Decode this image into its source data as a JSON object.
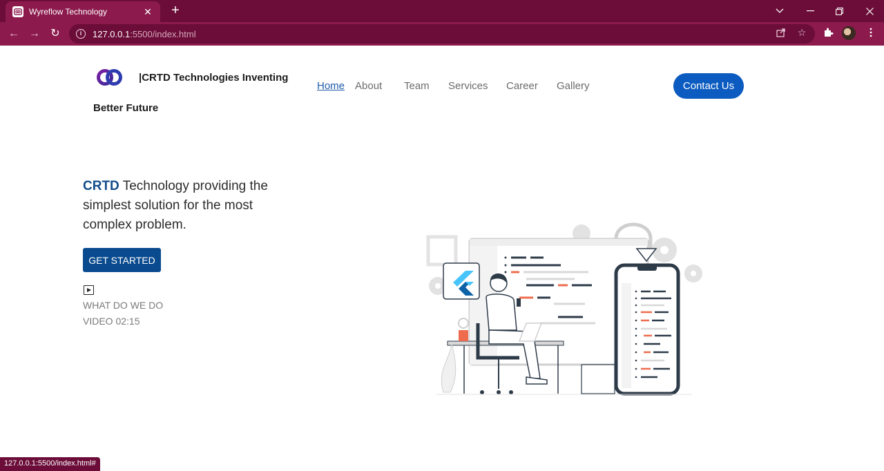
{
  "browser": {
    "tab_title": "Wyreflow Technology",
    "url_host": "127.0.0.1",
    "url_rest": ":5500/index.html",
    "status_url": "127.0.0.1:5500/index.html#"
  },
  "header": {
    "brand_line1": "|CRTD Technologies Inventing",
    "brand_line2": "Better Future",
    "nav": [
      "Home",
      "About",
      "Team",
      "Services",
      "Career",
      "Gallery"
    ],
    "contact_label": "Contact Us"
  },
  "hero": {
    "accent": "CRTD",
    "headline_rest": " Technology providing the simplest solution for the most complex problem.",
    "cta_label": "GET STARTED",
    "video_line1": "WHAT DO WE DO",
    "video_line2": "VIDEO 02:15"
  },
  "colors": {
    "chrome": "#6b0d38",
    "chrome_light": "#8c1a4d",
    "primary_button": "#0b5bc0",
    "cta_button": "#0a4a8e",
    "accent_text": "#124c8a"
  }
}
